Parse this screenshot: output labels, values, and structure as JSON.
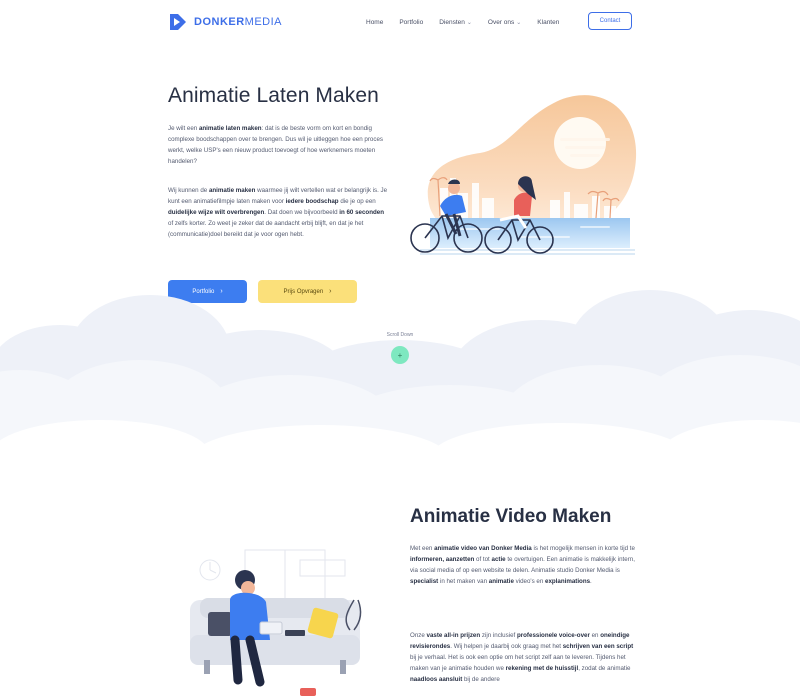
{
  "header": {
    "logo": {
      "bold": "DONKER",
      "thin": "MEDIA"
    },
    "nav": [
      {
        "label": "Home",
        "has_dropdown": false
      },
      {
        "label": "Portfolio",
        "has_dropdown": false
      },
      {
        "label": "Diensten",
        "has_dropdown": true
      },
      {
        "label": "Over ons",
        "has_dropdown": true
      },
      {
        "label": "Klanten",
        "has_dropdown": false
      }
    ],
    "contact_label": "Contact"
  },
  "hero": {
    "title": "Animatie Laten Maken",
    "paragraph1": [
      {
        "t": "Je wilt een "
      },
      {
        "t": "animatie laten maken",
        "b": true
      },
      {
        "t": ": dat is de beste vorm om kort en bondig complexe boodschappen over te brengen. Dus wil je uitleggen hoe een proces werkt, welke USP's een nieuw product toevoegt of hoe werknemers moeten handelen?"
      }
    ],
    "paragraph2": [
      {
        "t": "Wij kunnen de "
      },
      {
        "t": "animatie maken",
        "b": true
      },
      {
        "t": " waarmee jij wilt vertellen wat er belangrijk is. Je kunt een animatiefilmpje laten maken voor "
      },
      {
        "t": "iedere boodschap",
        "b": true
      },
      {
        "t": " die je op een "
      },
      {
        "t": "duidelijke wijze wilt overbrengen",
        "b": true
      },
      {
        "t": ". Dat doen we bijvoorbeeld "
      },
      {
        "t": "in 60 seconden",
        "b": true
      },
      {
        "t": " of zelfs korter. Zo weet je zeker dat de aandacht erbij blijft, en dat je het (communicatie)doel bereikt dat je voor ogen hebt."
      }
    ],
    "primary_button": "Portfolio",
    "secondary_button": "Prijs Opvragen",
    "arrow_glyph": "›"
  },
  "scroll": {
    "label": "Scroll Down",
    "glyph": "+"
  },
  "section2": {
    "title": "Animatie Video Maken",
    "paragraph1": [
      {
        "t": "Met een "
      },
      {
        "t": "animatie video van Donker Media",
        "b": true
      },
      {
        "t": " is het mogelijk mensen in korte tijd te "
      },
      {
        "t": "informeren, aanzetten",
        "b": true
      },
      {
        "t": " of tot "
      },
      {
        "t": "actie",
        "b": true
      },
      {
        "t": " te overtuigen. Een animatie is makkelijk intern, via social media of op een website te delen. Animatie studio Donker Media is "
      },
      {
        "t": "specialist",
        "b": true
      },
      {
        "t": " in het maken van "
      },
      {
        "t": "animatie",
        "b": true
      },
      {
        "t": " video's en "
      },
      {
        "t": "explanimations",
        "b": true
      },
      {
        "t": "."
      }
    ],
    "paragraph2": [
      {
        "t": "Onze "
      },
      {
        "t": "vaste all-in prijzen",
        "b": true
      },
      {
        "t": " zijn inclusief "
      },
      {
        "t": "professionele voice-over",
        "b": true
      },
      {
        "t": " en "
      },
      {
        "t": "oneindige revisierondes",
        "b": true
      },
      {
        "t": ". Wij helpen je daarbij ook graag met het "
      },
      {
        "t": "schrijven van een script",
        "b": true
      },
      {
        "t": " bij je verhaal. Het is ook een optie om het script zelf aan te leveren. Tijdens het maken van je animatie houden we "
      },
      {
        "t": "rekening met de huisstijl",
        "b": true
      },
      {
        "t": ", zodat de animatie "
      },
      {
        "t": "naadloos aansluit",
        "b": true
      },
      {
        "t": " bij de andere"
      }
    ]
  },
  "colors": {
    "brand_blue": "#3d6ee8",
    "primary_button": "#3d7df0",
    "secondary_button": "#fbe07a",
    "scroll_button": "#7ee8c0",
    "heading": "#283044"
  },
  "icons": [
    "logo-mark",
    "chevron-down-icon",
    "chevron-right-icon",
    "plus-icon"
  ]
}
